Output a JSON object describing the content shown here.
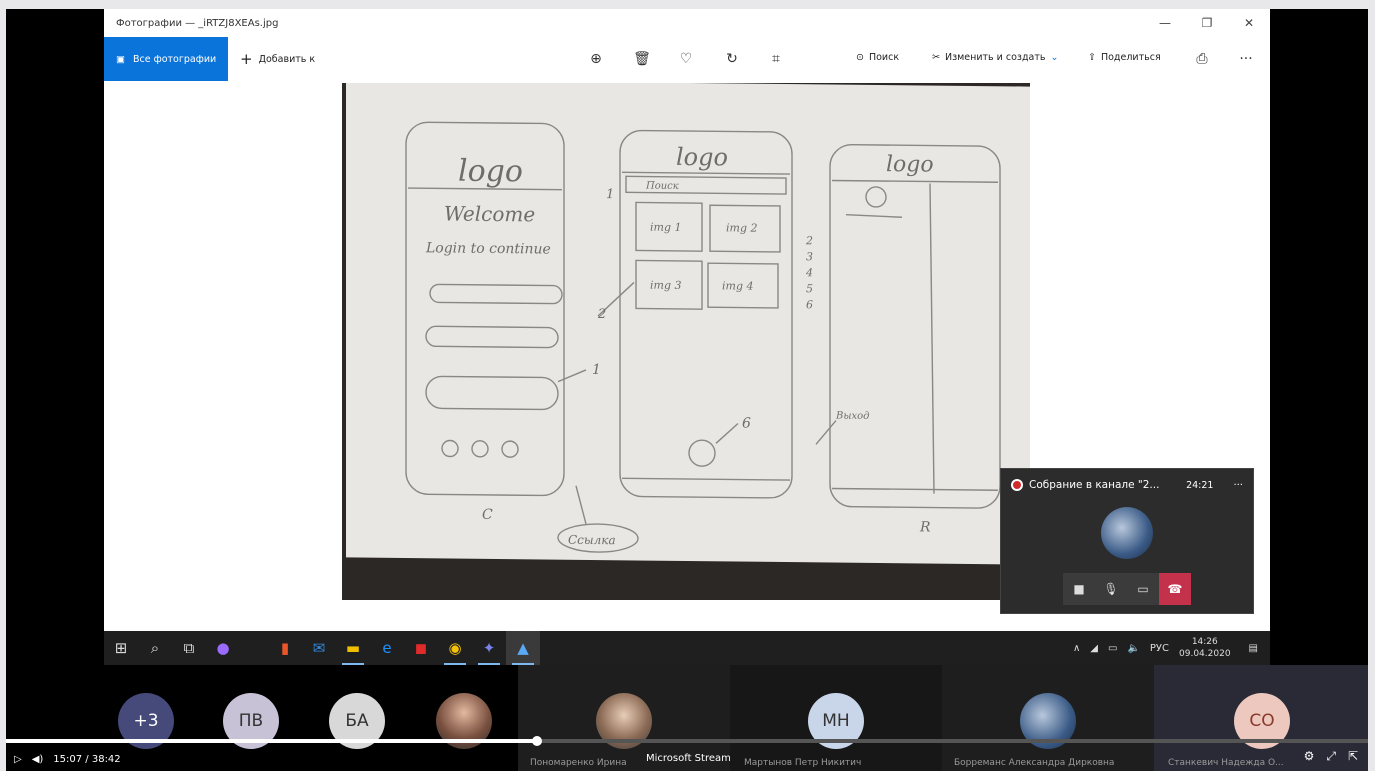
{
  "photos": {
    "window_title": "Фотографии — _iRTZJ8XEAs.jpg",
    "all_photos": "Все фотографии",
    "add_to": "Добавить к",
    "search": "Поиск",
    "edit_create": "Изменить и создать",
    "share": "Поделиться"
  },
  "meeting": {
    "title": "Собрание в канале \"2...",
    "time": "24:21"
  },
  "taskbar": {
    "lang": "РУС",
    "time": "14:26",
    "date": "09.04.2020"
  },
  "participants": [
    {
      "initials": "+3",
      "color": "#454a7a"
    },
    {
      "initials": "ПВ",
      "color": "#c8c2d6"
    },
    {
      "initials": "БА",
      "color": "#d8d8d8"
    },
    {
      "name": "Пономаренко Ирина"
    },
    {
      "initials": "МН",
      "color": "#c9d6ea",
      "name": "Мартынов Петр Никитич"
    },
    {
      "name": "Борреманс Александра Дирковна"
    },
    {
      "initials": "СО",
      "color": "#ecc8bf",
      "name": "Станкевич Надежда О..."
    }
  ],
  "player": {
    "time": "15:07 / 38:42",
    "stream_label": "Microsoft Stream",
    "progress": 0.39
  },
  "sketch": {
    "screen1": [
      "logo",
      "Welcome",
      "Login to continue",
      "1",
      "C"
    ],
    "screen2": [
      "logo",
      "Поиск",
      "img 1",
      "img 2",
      "img 3",
      "img 4",
      "1",
      "2",
      "6"
    ],
    "screen3": [
      "logo",
      "2",
      "3",
      "4",
      "5",
      "6",
      "Выход",
      "R"
    ],
    "bottom": "Ссылка"
  }
}
